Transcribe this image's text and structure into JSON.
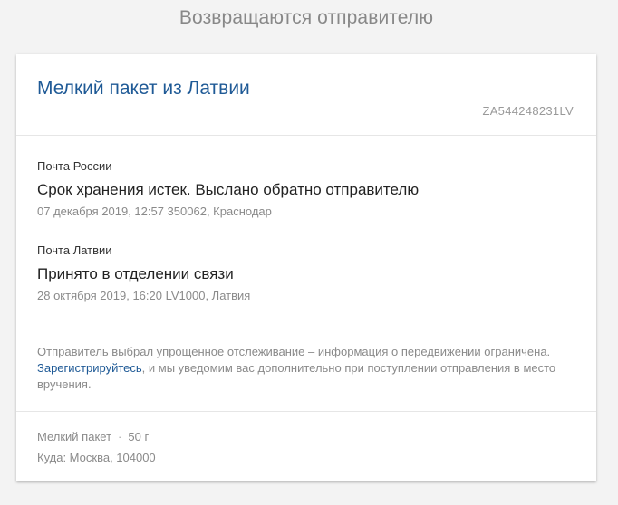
{
  "page": {
    "heading": "Возвращаются отправителю"
  },
  "parcel": {
    "title": "Мелкий пакет из Латвии",
    "track_number": "ZA544248231LV"
  },
  "events": [
    {
      "carrier": "Почта России",
      "status": "Срок хранения истек. Выслано обратно отправителю",
      "meta": "07 декабря 2019, 12:57 350062, Краснодар"
    },
    {
      "carrier": "Почта Латвии",
      "status": "Принято в отделении связи",
      "meta": "28 октября 2019, 16:20 LV1000, Латвия"
    }
  ],
  "notice": {
    "text_before": "Отправитель выбрал упрощенное отслеживание – информация о передвижении ограничена. ",
    "link_label": "Зарегистрируйтесь",
    "text_after": ", и мы уведомим вас дополнительно при поступлении отправления в место вручения."
  },
  "footer": {
    "type": "Мелкий пакет",
    "separator": "·",
    "weight": "50 г",
    "destination": "Куда: Москва, 104000"
  },
  "colors": {
    "title": "#1f5a96",
    "link": "#1f5a96",
    "muted": "#8a8a8a",
    "background": "#f3f3f3"
  }
}
